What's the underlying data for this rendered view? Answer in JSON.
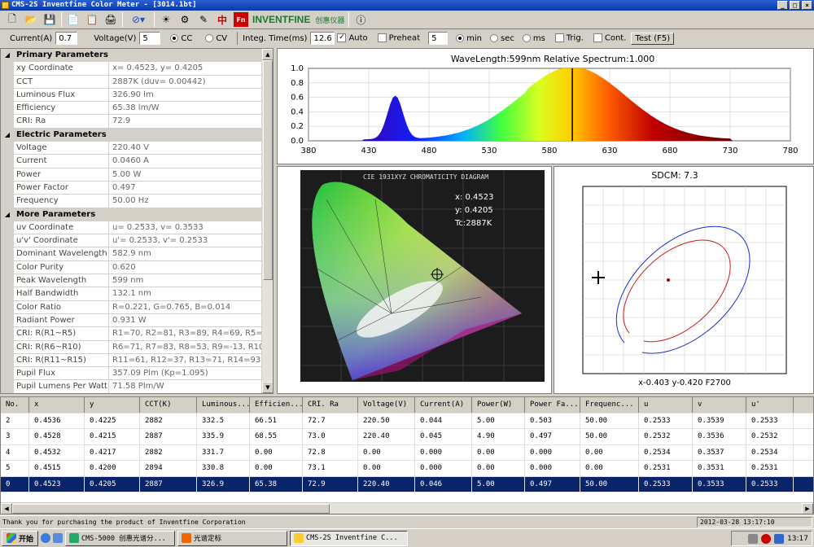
{
  "window": {
    "title": "CMS-2S Inventfine Color Meter - [3014.1bt]",
    "minimize": "_",
    "maximize": "□",
    "close": "×"
  },
  "toolbar": {
    "brand": "INVENTFINE",
    "brand_cn": "创惠仪器"
  },
  "controls": {
    "current_label": "Current(A)",
    "current_value": "0.7",
    "voltage_label": "Voltage(V)",
    "voltage_value": "5",
    "cc_label": "CC",
    "cv_label": "CV",
    "integ_label": "Integ. Time(ms)",
    "integ_value": "12.6",
    "auto_label": "Auto",
    "preheat_label": "Preheat",
    "preheat_value": "5",
    "min_label": "min",
    "sec_label": "sec",
    "ms_label": "ms",
    "trig_label": "Trig.",
    "cont_label": "Cont.",
    "test_label": "Test (F5)"
  },
  "properties": [
    {
      "header": "Primary Parameters"
    },
    {
      "k": "xy Coordinate",
      "v": "x= 0.4523, y= 0.4205"
    },
    {
      "k": "CCT",
      "v": "2887K (duv= 0.00442)"
    },
    {
      "k": "Luminous Flux",
      "v": "326.90 lm"
    },
    {
      "k": "Efficiency",
      "v": "65.38 lm/W"
    },
    {
      "k": "CRI: Ra",
      "v": "72.9"
    },
    {
      "header": "Electric Parameters"
    },
    {
      "k": "Voltage",
      "v": "220.40 V"
    },
    {
      "k": "Current",
      "v": "0.0460 A"
    },
    {
      "k": "Power",
      "v": "5.00 W"
    },
    {
      "k": "Power Factor",
      "v": "0.497"
    },
    {
      "k": "Frequency",
      "v": "50.00 Hz"
    },
    {
      "header": "More Parameters"
    },
    {
      "k": "uv Coordinate",
      "v": "u= 0.2533, v= 0.3533"
    },
    {
      "k": "u'v' Coordinate",
      "v": "u'= 0.2533, v'= 0.2533"
    },
    {
      "k": "Dominant Wavelength",
      "v": "582.9 nm"
    },
    {
      "k": "Color Purity",
      "v": "0.620"
    },
    {
      "k": "Peak Wavelength",
      "v": "599 nm"
    },
    {
      "k": "Half Bandwidth",
      "v": "132.1 nm"
    },
    {
      "k": "Color Ratio",
      "v": "R=0.221, G=0.765, B=0.014"
    },
    {
      "k": "Radiant Power",
      "v": "0.931 W"
    },
    {
      "k": "CRI: R(R1~R5)",
      "v": "R1=70, R2=81, R3=89, R4=69, R5=69"
    },
    {
      "k": "CRI: R(R6~R10)",
      "v": "R6=71, R7=83, R8=53, R9=-13, R10=46"
    },
    {
      "k": "CRI: R(R11~R15)",
      "v": "R11=61, R12=37, R13=71, R14=93, R15=61"
    },
    {
      "k": "Pupil Flux",
      "v": "357.09 Plm (Kp=1.095)"
    },
    {
      "k": "Pupil Lumens Per Watt",
      "v": "71.58 Plm/W"
    }
  ],
  "spectrum": {
    "title": "WaveLength:599nm  Relative Spectrum:1.000",
    "yticks": [
      "1.0",
      "0.8",
      "0.6",
      "0.4",
      "0.2",
      "0.0"
    ],
    "xticks": [
      "380",
      "430",
      "480",
      "530",
      "580",
      "630",
      "680",
      "730",
      "780"
    ],
    "marker_nm": 599
  },
  "cie": {
    "title": "CIE 1931XYZ CHROMATICITY DIAGRAM",
    "x_text": "x: 0.4523",
    "y_text": "y: 0.4205",
    "tc_text": "Tc:2887K"
  },
  "sdcm": {
    "title": "SDCM:   7.3",
    "readout": "x-0.403  y-0.420  F2700"
  },
  "table": {
    "columns": [
      "No.",
      "x",
      "y",
      "CCT(K)",
      "Luminous...",
      "Efficien...",
      "CRI. Ra",
      "Voltage(V)",
      "Current(A)",
      "Power(W)",
      "Power Fa...",
      "Frequenc...",
      "u",
      "v",
      "u'"
    ],
    "rows": [
      [
        "2",
        "0.4536",
        "0.4225",
        "2882",
        "332.5",
        "66.51",
        "72.7",
        "220.50",
        "0.044",
        "5.00",
        "0.503",
        "50.00",
        "0.2533",
        "0.3539",
        "0.2533"
      ],
      [
        "3",
        "0.4528",
        "0.4215",
        "2887",
        "335.9",
        "68.55",
        "73.0",
        "220.40",
        "0.045",
        "4.90",
        "0.497",
        "50.00",
        "0.2532",
        "0.3536",
        "0.2532"
      ],
      [
        "4",
        "0.4532",
        "0.4217",
        "2882",
        "331.7",
        "0.00",
        "72.8",
        "0.00",
        "0.000",
        "0.00",
        "0.000",
        "0.00",
        "0.2534",
        "0.3537",
        "0.2534"
      ],
      [
        "5",
        "0.4515",
        "0.4200",
        "2894",
        "330.8",
        "0.00",
        "73.1",
        "0.00",
        "0.000",
        "0.00",
        "0.000",
        "0.00",
        "0.2531",
        "0.3531",
        "0.2531"
      ],
      [
        "0",
        "0.4523",
        "0.4205",
        "2887",
        "326.9",
        "65.38",
        "72.9",
        "220.40",
        "0.046",
        "5.00",
        "0.497",
        "50.00",
        "0.2533",
        "0.3533",
        "0.2533"
      ]
    ],
    "selected_row": 4
  },
  "status": {
    "message": "Thank you for purchasing the product of Inventfine Corporation",
    "datetime": "2012-03-28 13:17:10"
  },
  "taskbar": {
    "start": "开始",
    "tasks": [
      "CMS-5000 创惠光谱分...",
      "光谱定标",
      "CMS-2S Inventfine C..."
    ],
    "clock": "13:17"
  }
}
